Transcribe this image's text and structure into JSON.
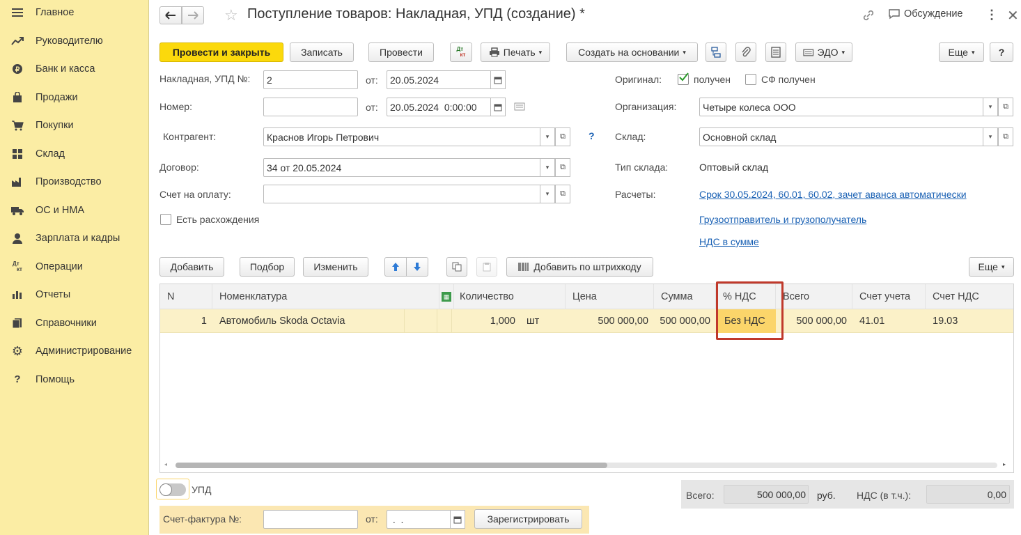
{
  "sidebar": {
    "items": [
      {
        "label": "Главное",
        "icon": "menu-icon"
      },
      {
        "label": "Руководителю",
        "icon": "trend-icon"
      },
      {
        "label": "Банк и касса",
        "icon": "bank-icon"
      },
      {
        "label": "Продажи",
        "icon": "bag-icon"
      },
      {
        "label": "Покупки",
        "icon": "cart-icon"
      },
      {
        "label": "Склад",
        "icon": "warehouse-icon"
      },
      {
        "label": "Производство",
        "icon": "factory-icon"
      },
      {
        "label": "ОС и НМА",
        "icon": "truck-icon"
      },
      {
        "label": "Зарплата и кадры",
        "icon": "person-icon"
      },
      {
        "label": "Операции",
        "icon": "dt-kt-icon"
      },
      {
        "label": "Отчеты",
        "icon": "bar-chart-icon"
      },
      {
        "label": "Справочники",
        "icon": "books-icon"
      },
      {
        "label": "Администрирование",
        "icon": "gear-icon"
      },
      {
        "label": "Помощь",
        "icon": "question-icon"
      }
    ]
  },
  "header": {
    "title": "Поступление товаров: Накладная, УПД (создание) *",
    "discussion": "Обсуждение"
  },
  "toolbar": {
    "post_close": "Провести и закрыть",
    "save": "Записать",
    "post": "Провести",
    "dtkt_top": "Дт",
    "dtkt_bottom": "кт",
    "print": "Печать",
    "create_based": "Создать на основании",
    "edo": "ЭДО",
    "more": "Еще",
    "help": "?"
  },
  "form": {
    "invoice_label": "Накладная, УПД №:",
    "invoice_value": "2",
    "from_label": "от:",
    "invoice_date": "20.05.2024",
    "number_label": "Номер:",
    "number_value": "",
    "number_date": "20.05.2024  0:00:00",
    "counterparty_label": "Контрагент:",
    "counterparty_value": "Краснов Игорь Петрович",
    "contract_label": "Договор:",
    "contract_value": "34 от 20.05.2024",
    "payment_label": "Счет на оплату:",
    "payment_value": "",
    "discrepancy_label": "Есть расхождения",
    "original_label": "Оригинал:",
    "received_label": "получен",
    "sf_received_label": "СФ получен",
    "org_label": "Организация:",
    "org_value": "Четыре колеса ООО",
    "warehouse_label": "Склад:",
    "warehouse_value": "Основной склад",
    "warehouse_type_label": "Тип склада:",
    "warehouse_type_value": "Оптовый склад",
    "settlements_label": "Расчеты:",
    "settlements_link": "Срок 30.05.2024, 60.01, 60.02, зачет аванса автоматически",
    "shipper_link": "Грузоотправитель и грузополучатель",
    "vat_link": "НДС в сумме",
    "question_mark": "?"
  },
  "table_toolbar": {
    "add": "Добавить",
    "pick": "Подбор",
    "edit": "Изменить",
    "barcode": "Добавить по штрихкоду",
    "more": "Еще"
  },
  "table": {
    "columns": [
      "N",
      "Номенклатура",
      "Количество",
      "Цена",
      "Сумма",
      "% НДС",
      "Всего",
      "Счет учета",
      "Счет НДС"
    ],
    "rows": [
      {
        "n": "1",
        "item": "Автомобиль Skoda Octavia",
        "qty": "1,000",
        "unit": "шт",
        "price": "500 000,00",
        "sum": "500 000,00",
        "vat_rate": "Без НДС",
        "total": "500 000,00",
        "account": "41.01",
        "vat_account": "19.03"
      }
    ]
  },
  "footer": {
    "upd_label": "УПД",
    "total_label": "Всего:",
    "total_value": "500 000,00",
    "currency": "руб.",
    "vat_label": "НДС (в т.ч.):",
    "vat_value": "0,00",
    "sf_label": "Счет-фактура №:",
    "sf_value": "",
    "sf_from": "от:",
    "sf_date": " .  .",
    "register": "Зарегистрировать"
  },
  "colors": {
    "sidebar_bg": "#fbeda4",
    "primary_button": "#fbd90c",
    "selected_row": "#fbf1c8",
    "highlight_box": "#c0392b",
    "link": "#1a61b4"
  }
}
